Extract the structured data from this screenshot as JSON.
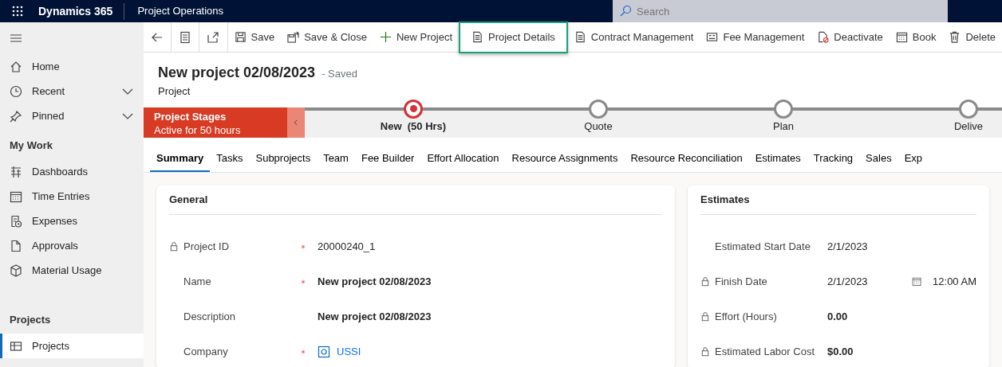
{
  "app_bar": {
    "app_name": "Dynamics 365",
    "area": "Project Operations",
    "search": {
      "placeholder": "Search"
    }
  },
  "sidebar": {
    "items": [
      {
        "kind": "link",
        "label": "Home",
        "selected": false
      },
      {
        "kind": "group",
        "label": "Recent",
        "selected": false
      },
      {
        "kind": "group",
        "label": "Pinned",
        "selected": false
      },
      {
        "kind": "heading",
        "label": "My Work"
      },
      {
        "kind": "link",
        "label": "Dashboards",
        "selected": false
      },
      {
        "kind": "link",
        "label": "Time Entries",
        "selected": false
      },
      {
        "kind": "link",
        "label": "Expenses",
        "selected": false
      },
      {
        "kind": "link",
        "label": "Approvals",
        "selected": false
      },
      {
        "kind": "link",
        "label": "Material Usage",
        "selected": false
      },
      {
        "kind": "heading",
        "label": "Projects"
      },
      {
        "kind": "link",
        "label": "Projects",
        "selected": true
      }
    ]
  },
  "command_bar": {
    "commands": [
      {
        "label": "Save",
        "highlighted": false
      },
      {
        "label": "Save & Close",
        "highlighted": false
      },
      {
        "label": "New Project",
        "highlighted": false
      },
      {
        "label": "Project Details",
        "highlighted": true
      },
      {
        "label": "Contract Management",
        "highlighted": false
      },
      {
        "label": "Fee Management",
        "highlighted": false
      },
      {
        "label": "Deactivate",
        "highlighted": false
      },
      {
        "label": "Book",
        "highlighted": false
      },
      {
        "label": "Delete",
        "highlighted": false
      }
    ]
  },
  "header": {
    "title": "New project 02/08/2023",
    "status": "- Saved",
    "entity": "Project"
  },
  "stages": {
    "label": "Project Stages",
    "duration": "Active for 50 hours",
    "items": [
      {
        "name": "New  (50 Hrs)",
        "active": true
      },
      {
        "name": "Quote",
        "active": false
      },
      {
        "name": "Plan",
        "active": false
      },
      {
        "name": "Delive",
        "active": false
      }
    ]
  },
  "tabs": [
    {
      "label": "Summary",
      "selected": true
    },
    {
      "label": "Tasks",
      "selected": false
    },
    {
      "label": "Subprojects",
      "selected": false
    },
    {
      "label": "Team",
      "selected": false
    },
    {
      "label": "Fee Builder",
      "selected": false
    },
    {
      "label": "Effort Allocation",
      "selected": false
    },
    {
      "label": "Resource Assignments",
      "selected": false
    },
    {
      "label": "Resource Reconciliation",
      "selected": false
    },
    {
      "label": "Estimates",
      "selected": false
    },
    {
      "label": "Tracking",
      "selected": false
    },
    {
      "label": "Sales",
      "selected": false
    },
    {
      "label": "Exp",
      "selected": false
    }
  ],
  "sections": [
    {
      "title": "General",
      "fields": [
        {
          "label": "Project ID",
          "locked": true,
          "required": true,
          "value": "20000240_1",
          "kind": "text"
        },
        {
          "label": "Name",
          "locked": false,
          "required": true,
          "value": "New project 02/08/2023",
          "kind": "bold"
        },
        {
          "label": "Description",
          "locked": false,
          "required": false,
          "value": "New project 02/08/2023",
          "kind": "bold"
        },
        {
          "label": "Company",
          "locked": false,
          "required": true,
          "value": "USSI",
          "kind": "lookup"
        }
      ]
    },
    {
      "title": "Estimates",
      "fields": [
        {
          "label": "Estimated Start Date",
          "locked": false,
          "value": "2/1/2023",
          "kind": "text"
        },
        {
          "label": "Finish Date",
          "locked": true,
          "value": "2/1/2023",
          "kind": "datetime",
          "time": "12:00 AM"
        },
        {
          "label": "Effort (Hours)",
          "locked": true,
          "value": "0.00",
          "kind": "bold"
        },
        {
          "label": "Estimated Labor Cost",
          "locked": true,
          "value": "$0.00",
          "kind": "bold"
        }
      ]
    }
  ]
}
